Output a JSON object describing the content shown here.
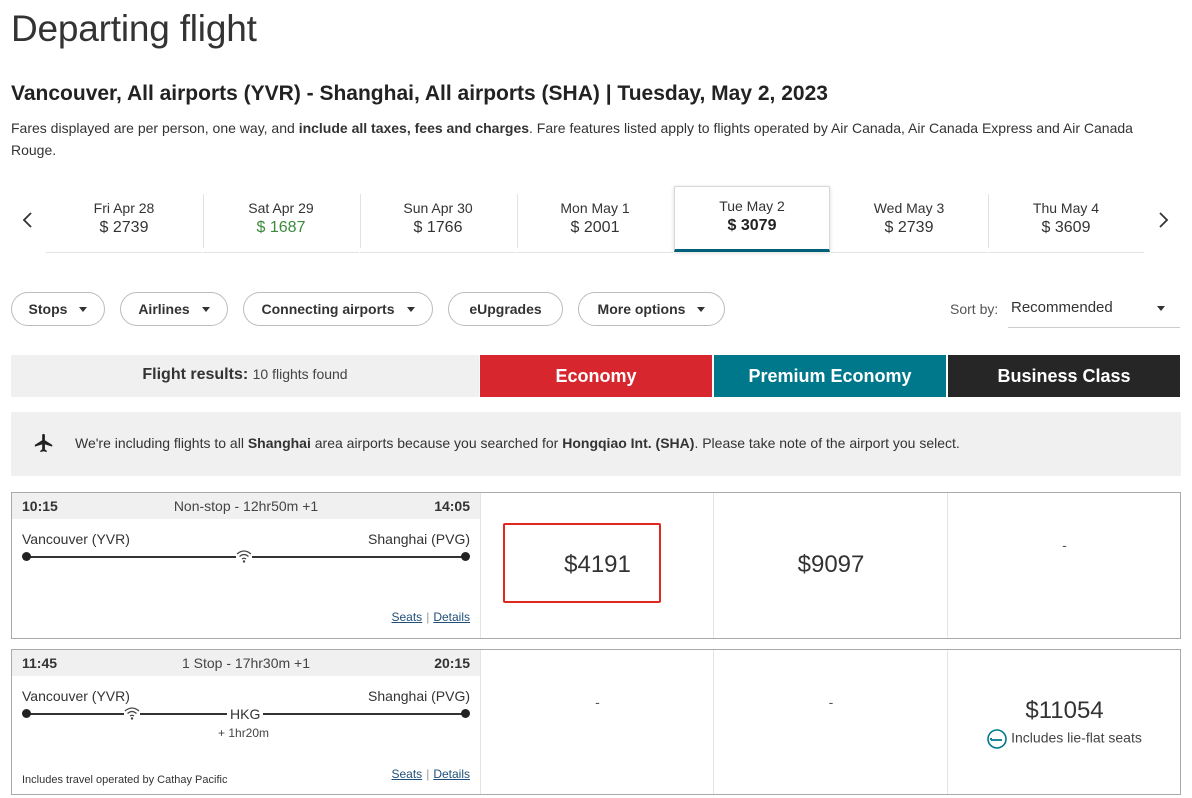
{
  "page": {
    "title": "Departing flight",
    "route": "Vancouver, All airports (YVR) - Shanghai, All airports (SHA) | Tuesday, May 2, 2023",
    "fare_note_1": "Fares displayed are per person, one way, and ",
    "fare_note_bold": "include all taxes, fees and charges",
    "fare_note_2": ". Fare features listed apply to flights operated by Air Canada, Air Canada Express and Air Canada Rouge."
  },
  "dates": [
    {
      "label": "Fri Apr 28",
      "price": "$ 2739"
    },
    {
      "label": "Sat Apr 29",
      "price": "$ 1687"
    },
    {
      "label": "Sun Apr 30",
      "price": "$ 1766"
    },
    {
      "label": "Mon May 1",
      "price": "$ 2001"
    },
    {
      "label": "Tue May 2",
      "price": "$ 3079"
    },
    {
      "label": "Wed May 3",
      "price": "$ 2739"
    },
    {
      "label": "Thu May 4",
      "price": "$ 3609"
    }
  ],
  "filters": {
    "stops": "Stops",
    "airlines": "Airlines",
    "connecting": "Connecting airports",
    "eupgrades": "eUpgrades",
    "more": "More options",
    "sort_label": "Sort by:",
    "sort_value": "Recommended"
  },
  "cabins": {
    "results_label": "Flight results:",
    "results_count": "10 flights found",
    "economy": "Economy",
    "premium": "Premium Economy",
    "business": "Business Class",
    "economy_color": "#d8262e",
    "premium_color": "#00788c",
    "business_color": "#262626"
  },
  "notice": {
    "text_1": "We're including flights to all ",
    "city": "Shanghai",
    "text_2": " area airports because you searched for ",
    "airport": "Hongqiao Int. (SHA)",
    "text_3": ". Please take note of the airport you select.",
    "icon": "airplane-icon"
  },
  "flights": [
    {
      "depart": "10:15",
      "duration": "Non-stop - 12hr50m +1",
      "arrive": "14:05",
      "origin": "Vancouver (YVR)",
      "destination": "Shanghai (PVG)",
      "seats": "Seats",
      "details": "Details",
      "economy": "$4191",
      "premium": "$9097",
      "business": "-"
    },
    {
      "depart": "11:45",
      "duration": "1 Stop - 17hr30m +1",
      "arrive": "20:15",
      "origin": "Vancouver (YVR)",
      "destination": "Shanghai (PVG)",
      "connection": "HKG",
      "connection_time": "+ 1hr20m",
      "operated": "Includes travel operated by Cathay Pacific",
      "seats": "Seats",
      "details": "Details",
      "economy": "-",
      "premium": "-",
      "business": "$11054",
      "business_note": "Includes lie-flat seats"
    }
  ]
}
